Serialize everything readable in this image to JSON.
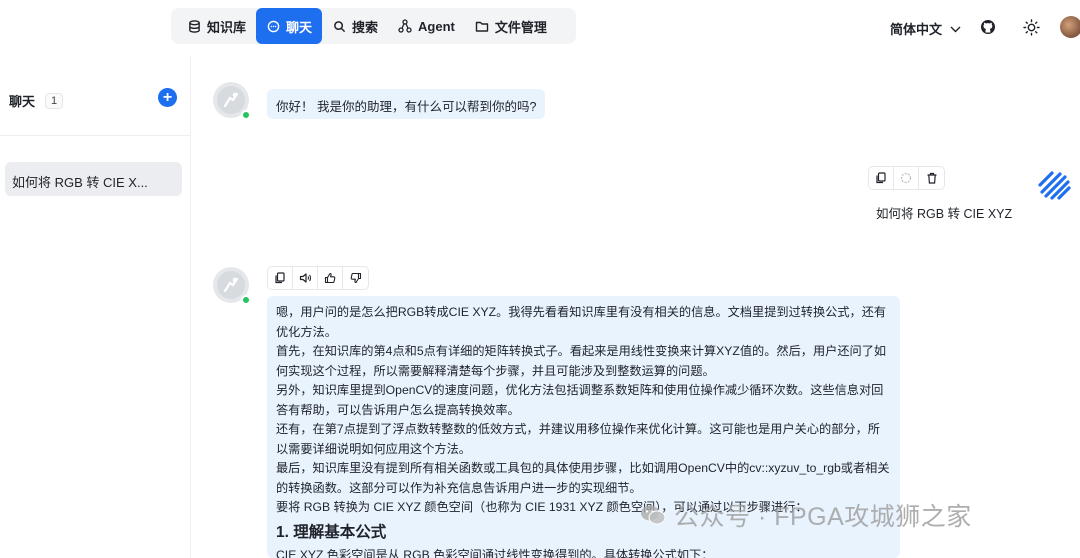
{
  "nav": {
    "items": [
      {
        "label": "知识库",
        "icon": "database-icon",
        "active": false
      },
      {
        "label": "聊天",
        "icon": "chat-icon",
        "active": true
      },
      {
        "label": "搜索",
        "icon": "search-icon",
        "active": false
      },
      {
        "label": "Agent",
        "icon": "agent-icon",
        "active": false
      },
      {
        "label": "文件管理",
        "icon": "folder-icon",
        "active": false
      }
    ]
  },
  "header": {
    "language": "简体中文"
  },
  "sidebar": {
    "title": "聊天",
    "count": "1",
    "conversations": [
      {
        "title": "如何将 RGB 转 CIE X..."
      }
    ]
  },
  "chat": {
    "greeting": "你好！ 我是你的助理，有什么可以帮到你的吗?",
    "user_message": "如何将 RGB 转 CIE XYZ",
    "answer": {
      "paragraphs": [
        "嗯，用户问的是怎么把RGB转成CIE XYZ。我得先看看知识库里有没有相关的信息。文档里提到过转换公式，还有优化方法。",
        "首先，在知识库的第4点和5点有详细的矩阵转换式子。看起来是用线性变换来计算XYZ值的。然后，用户还问了如何实现这个过程，所以需要解释清楚每个步骤，并且可能涉及到整数运算的问题。",
        "另外，知识库里提到OpenCV的速度问题，优化方法包括调整系数矩阵和使用位操作减少循环次数。这些信息对回答有帮助，可以告诉用户怎么提高转换效率。",
        "还有，在第7点提到了浮点数转整数的低效方式，并建议用移位操作来优化计算。这可能也是用户关心的部分，所以需要详细说明如何应用这个方法。",
        "最后，知识库里没有提到所有相关函数或工具包的具体使用步骤，比如调用OpenCV中的cv::xyzuv_to_rgb或者相关的转换函数。这部分可以作为补充信息告诉用户进一步的实现细节。",
        "要将 RGB 转换为 CIE XYZ 颜色空间（也称为 CIE 1931 XYZ 颜色空间），可以通过以下步骤进行："
      ],
      "heading": "1. 理解基本公式",
      "last_line": "CIE XYZ 色彩空间是从 RGB 色彩空间通过线性变换得到的。具体转换公式如下："
    }
  },
  "watermark": "公众号 · FPGA攻城狮之家",
  "colors": {
    "accent": "#1e6ff0",
    "bubble": "#e8f3fe",
    "online": "#22c55e"
  }
}
